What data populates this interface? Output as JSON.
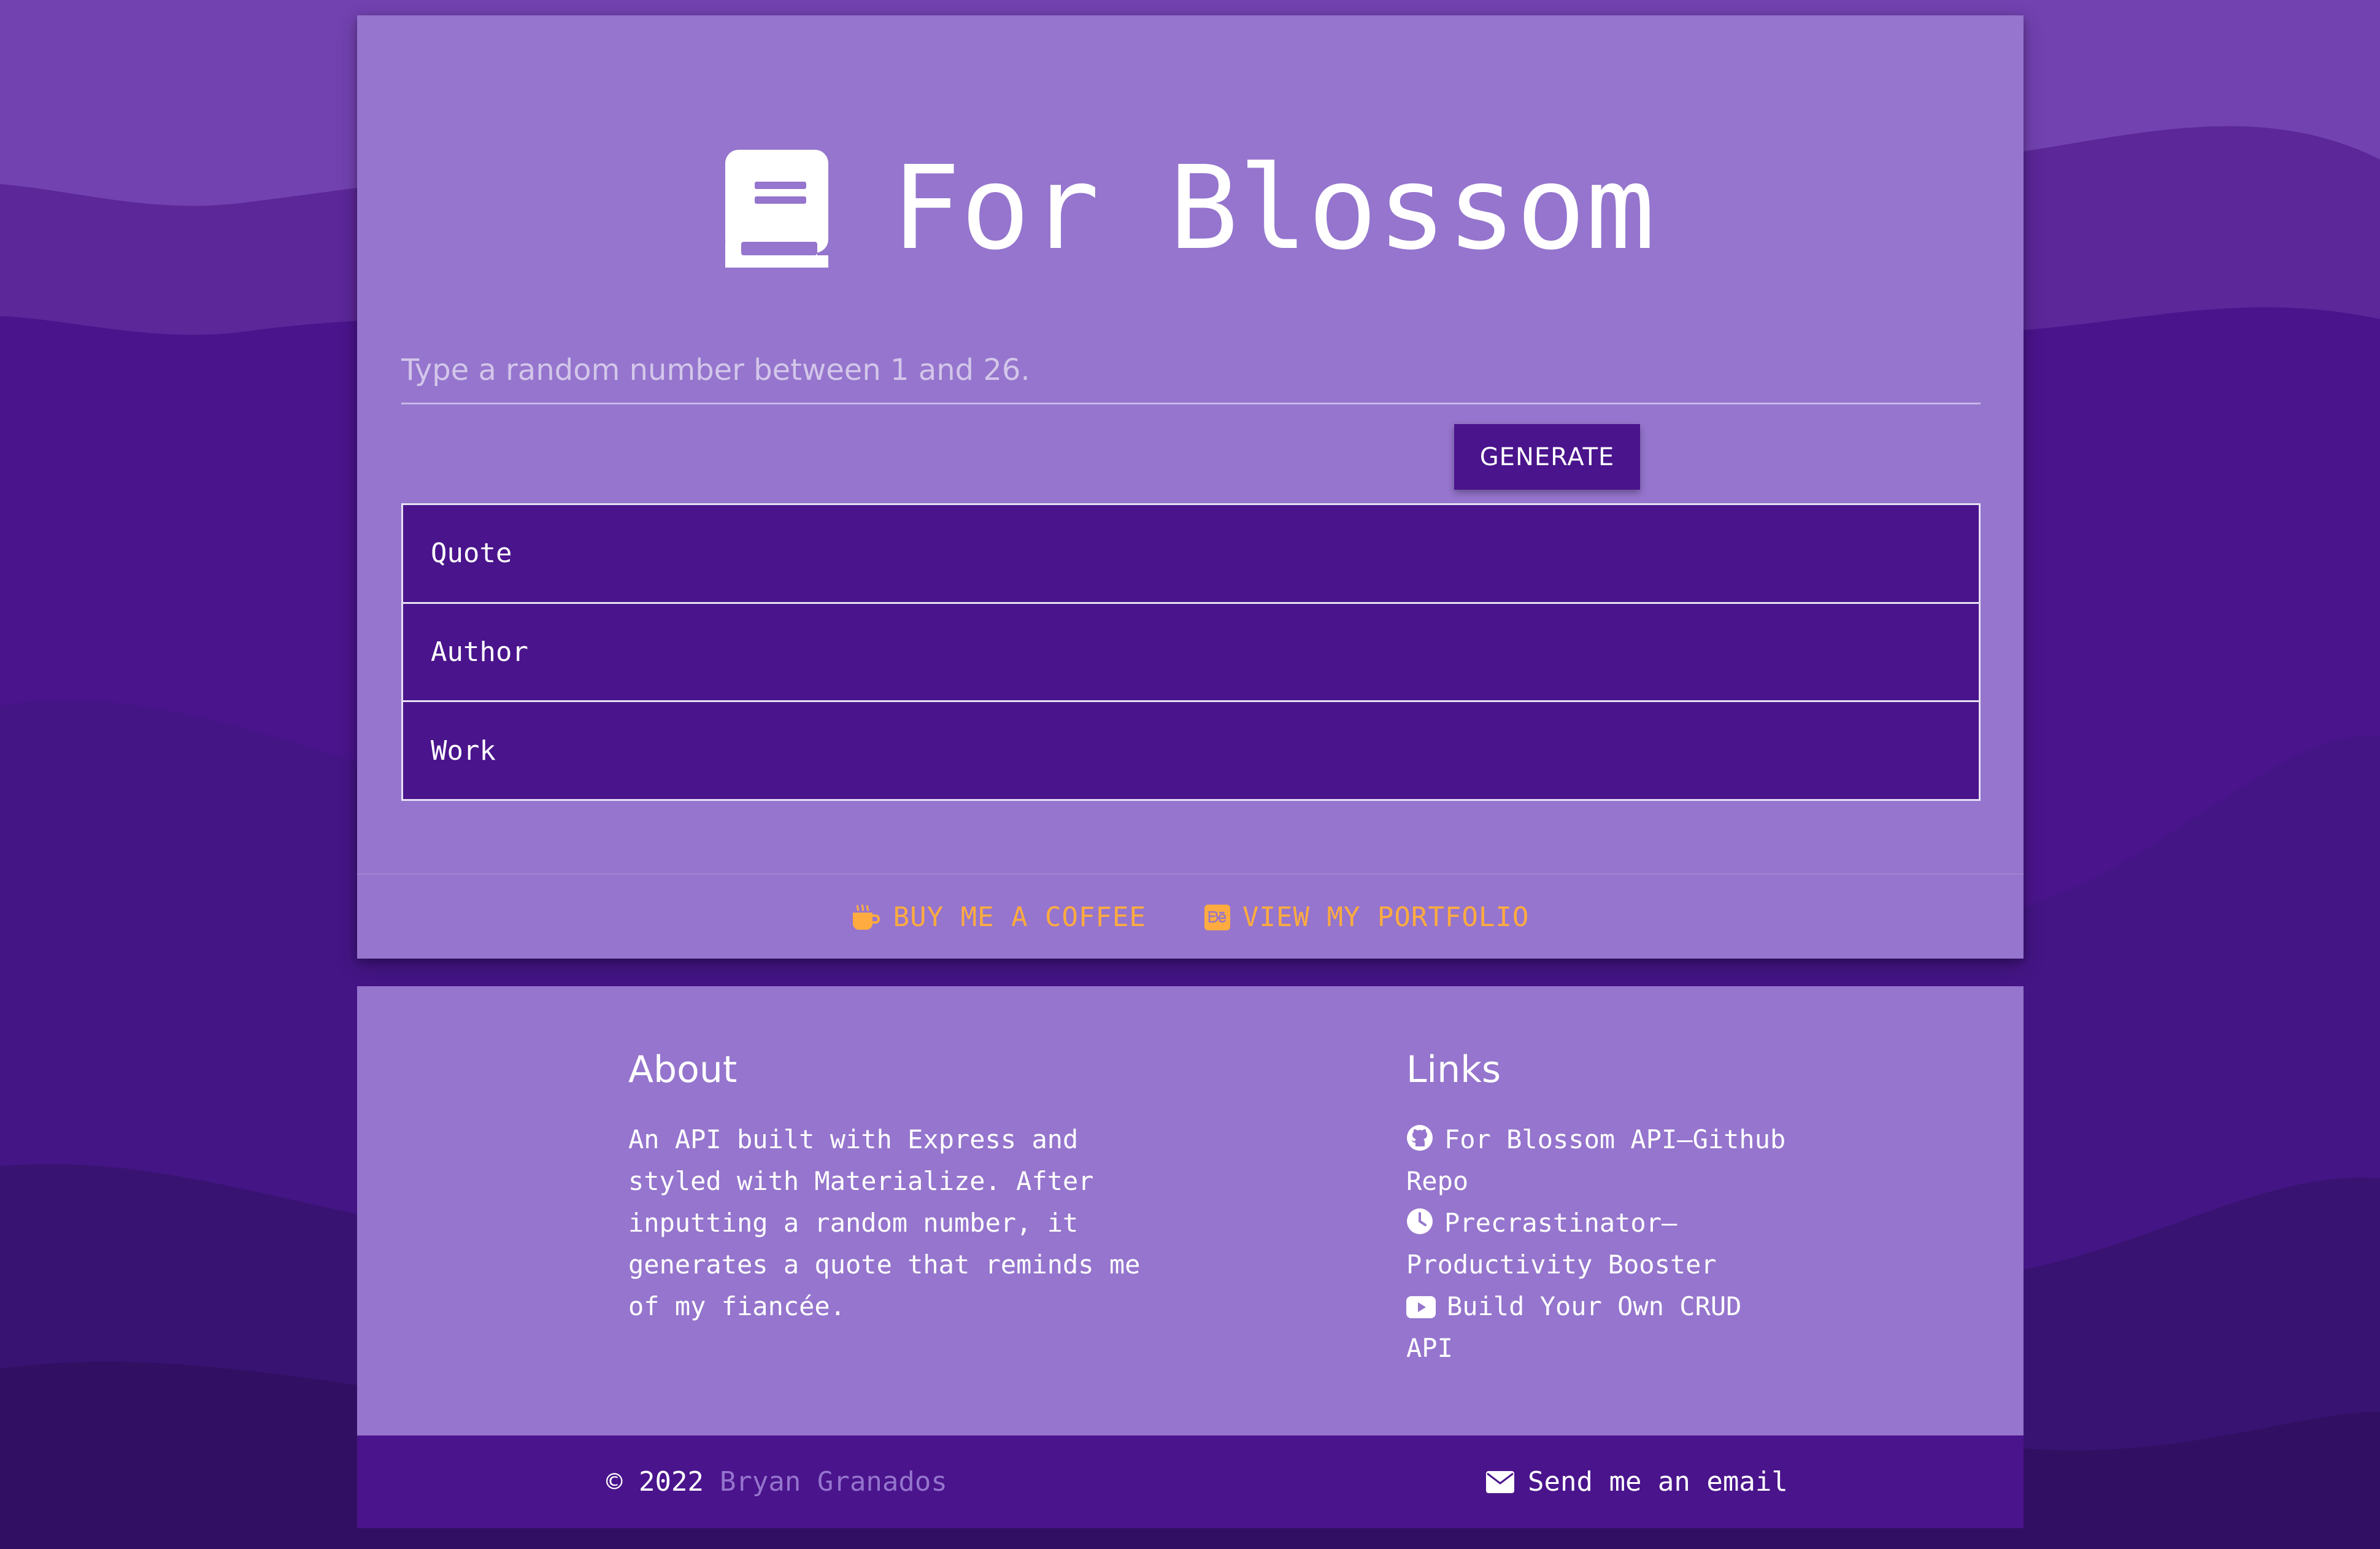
{
  "app": {
    "title": "For Blossom",
    "icon": "book-icon"
  },
  "form": {
    "number_placeholder": "Type a random number between 1 and 26.",
    "number_value": "",
    "generate_label": "GENERATE"
  },
  "results": {
    "quote_label": "Quote",
    "author_label": "Author",
    "work_label": "Work"
  },
  "card_actions": {
    "coffee_label": "BUY ME A COFFEE",
    "coffee_icon": "coffee-icon",
    "portfolio_label": "VIEW MY PORTFOLIO",
    "portfolio_icon": "behance-icon"
  },
  "footer": {
    "about": {
      "heading": "About",
      "text": "An API built with Express and styled with Materialize. After inputting a random number, it generates a quote that reminds me of my fiancée."
    },
    "links": {
      "heading": "Links",
      "items": [
        {
          "label": "For Blossom API—Github Repo",
          "icon": "github-icon"
        },
        {
          "label": "Precrastinator—Productivity Booster",
          "icon": "clock-icon"
        },
        {
          "label": "Build Your Own CRUD API",
          "icon": "youtube-icon"
        }
      ]
    },
    "copyright": {
      "prefix": "© 2022",
      "name": "Bryan Granados",
      "email_label": "Send me an email",
      "email_icon": "envelope-icon"
    }
  },
  "colors": {
    "primary": "#4a148c",
    "card": "#9575cd",
    "accent": "#ffab40"
  }
}
